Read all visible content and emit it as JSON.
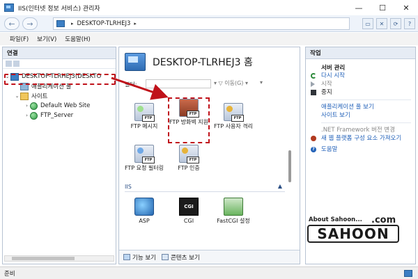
{
  "window": {
    "title": "IIS(인터넷 정보 서비스) 관리자",
    "controls": {
      "minimize": "—",
      "maximize": "☐",
      "close": "✕"
    }
  },
  "address_bar": {
    "back": "←",
    "forward": "→",
    "path": [
      "DESKTOP-TLRHEJ3"
    ],
    "separator": "▸"
  },
  "menu": [
    "파일(F)",
    "보기(V)",
    "도움말(H)"
  ],
  "connections": {
    "title": "연결",
    "tree": [
      {
        "label": "DESKTOP-TLRHEJ3(DESKTO",
        "level": 0,
        "expander": "⌄",
        "icon": "server"
      },
      {
        "label": "애플리케이션 풀",
        "level": 1,
        "expander": "",
        "icon": "app-pool"
      },
      {
        "label": "사이트",
        "level": 1,
        "expander": "⌄",
        "icon": "folder"
      },
      {
        "label": "Default Web Site",
        "level": 2,
        "expander": "›",
        "icon": "globe"
      },
      {
        "label": "FTP_Server",
        "level": 2,
        "expander": "›",
        "icon": "globe"
      }
    ]
  },
  "home": {
    "title": "DESKTOP-TLRHEJ3 홈",
    "filter_label": "필터:",
    "go_label": "▾ ▽ 이동(G) ▾",
    "ftp_tiles": [
      {
        "label": "FTP 메시지",
        "icon": "ftp-messages-icon"
      },
      {
        "label": "FTP 방화벽 지원",
        "icon": "ftp-firewall-icon"
      },
      {
        "label": "FTP 사용자 격리",
        "icon": "ftp-user-isolation-icon"
      },
      {
        "label": "FTP 요청 필터링",
        "icon": "ftp-request-filtering-icon"
      },
      {
        "label": "FTP 인증",
        "icon": "ftp-authentication-icon"
      }
    ],
    "iis_group": "IIS",
    "iis_tiles": [
      {
        "label": "ASP",
        "icon": "asp-icon"
      },
      {
        "label": "CGI",
        "icon": "cgi-icon",
        "badge": "CGI"
      },
      {
        "label": "FastCGI 설정",
        "icon": "fastcgi-icon"
      }
    ],
    "view_tabs": [
      "기능 보기",
      "콘텐츠 보기"
    ]
  },
  "actions": {
    "title": "작업",
    "server_section": "서버 관리",
    "items": [
      {
        "label": "다시 시작",
        "icon": "restart-icon",
        "enabled": true
      },
      {
        "label": "시작",
        "icon": "start-icon",
        "enabled": false
      },
      {
        "label": "중지",
        "icon": "stop-icon",
        "enabled": true
      }
    ],
    "links": [
      "애플리케이션 풀 보기",
      "사이트 보기"
    ],
    "links2": [
      ".NET Framework 버전 변경"
    ],
    "install": "새 웹 플랫폼 구성 요소 가져오기",
    "help": "도움말"
  },
  "watermark": {
    "top": "About Sahoon...",
    "com": ".com",
    "main": "SAHOON"
  },
  "status": {
    "text": "준비"
  },
  "colors": {
    "highlight": "#c0121a",
    "link": "#1f5fb8"
  }
}
